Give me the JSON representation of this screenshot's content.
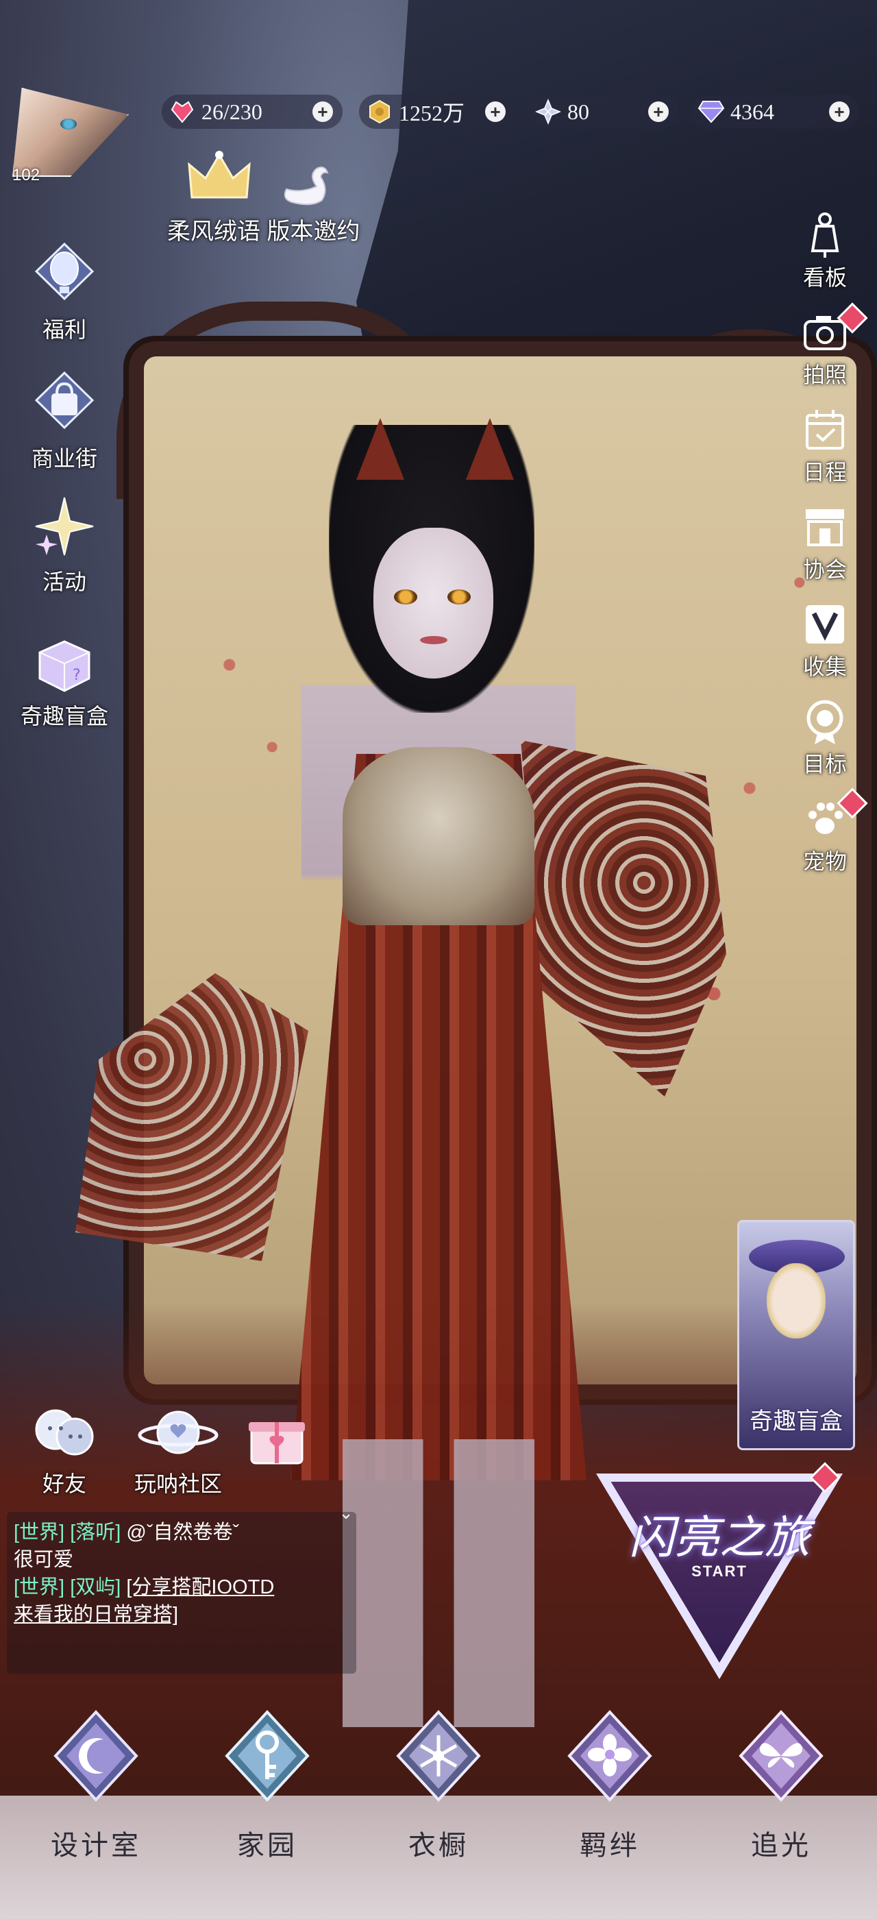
{
  "header": {
    "level": "102",
    "resources": [
      {
        "name": "stamina",
        "icon": "heart-gem-icon",
        "value": "26/230",
        "color": "#f0507a"
      },
      {
        "name": "gold",
        "icon": "gold-coin-icon",
        "value": "1252万",
        "color": "#e8b84a"
      },
      {
        "name": "crystal",
        "icon": "crystal-flower-icon",
        "value": "80",
        "color": "#b9c6e8"
      },
      {
        "name": "diamond",
        "icon": "diamond-icon",
        "value": "4364",
        "color": "#9a8af0"
      }
    ],
    "event_label": "柔风绒语 版本邀约"
  },
  "left_menu": [
    {
      "key": "welfare",
      "label": "福利",
      "icon": "hot-air-balloon-icon"
    },
    {
      "key": "shop",
      "label": "商业街",
      "icon": "shopping-bag-icon"
    },
    {
      "key": "events",
      "label": "活动",
      "icon": "sparkle-stars-icon"
    },
    {
      "key": "blindbox",
      "label": "奇趣盲盒",
      "icon": "mystery-box-icon"
    }
  ],
  "right_menu": [
    {
      "key": "board",
      "label": "看板",
      "icon": "mannequin-icon",
      "badge": false
    },
    {
      "key": "photo",
      "label": "拍照",
      "icon": "camera-icon",
      "badge": true
    },
    {
      "key": "schedule",
      "label": "日程",
      "icon": "calendar-check-icon",
      "badge": false
    },
    {
      "key": "guild",
      "label": "协会",
      "icon": "guild-building-icon",
      "badge": false
    },
    {
      "key": "collect",
      "label": "收集",
      "icon": "v-collection-icon",
      "badge": false
    },
    {
      "key": "goals",
      "label": "目标",
      "icon": "target-medal-icon",
      "badge": false
    },
    {
      "key": "pet",
      "label": "宠物",
      "icon": "paw-icon",
      "badge": true
    }
  ],
  "promo": {
    "label": "奇趣盲盒"
  },
  "social": [
    {
      "key": "friends",
      "label": "好友",
      "icon": "friends-bubble-icon"
    },
    {
      "key": "community",
      "label": "玩呐社区",
      "icon": "planet-heart-icon"
    },
    {
      "key": "gift",
      "label": "",
      "icon": "gift-box-icon"
    }
  ],
  "chat": {
    "messages": [
      {
        "channel": "[世界]",
        "user": "[落听]",
        "mention": "@ˇ自然卷卷ˇ",
        "text": "很可爱"
      },
      {
        "channel": "[世界]",
        "user": "[双屿]",
        "mention": "[分享搭配IOOTD",
        "text": "来看我的日常穿搭]"
      }
    ]
  },
  "journey": {
    "title": "闪亮之旅",
    "subtitle": "START"
  },
  "bottom_nav": [
    {
      "key": "studio",
      "label": "设计室",
      "icon": "crescent-moon-crest-icon",
      "color": "#b8a8f0"
    },
    {
      "key": "home",
      "label": "家园",
      "icon": "key-crest-icon",
      "color": "#a8d0f0"
    },
    {
      "key": "wardrobe",
      "label": "衣橱",
      "icon": "snowflake-crest-icon",
      "color": "#c8c0f0"
    },
    {
      "key": "bond",
      "label": "羁绊",
      "icon": "flower-crest-icon",
      "color": "#c8b0f0"
    },
    {
      "key": "chase",
      "label": "追光",
      "icon": "butterfly-crest-icon",
      "color": "#d0b8f0"
    }
  ]
}
